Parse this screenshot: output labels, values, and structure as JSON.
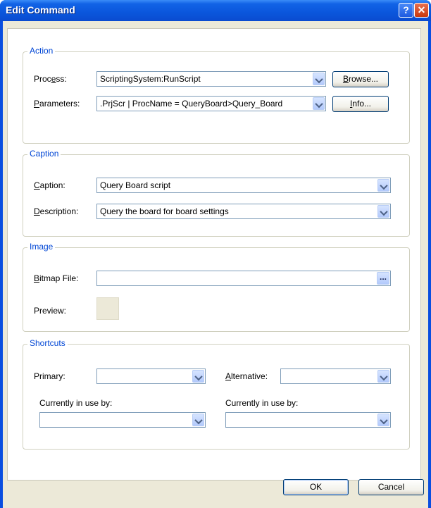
{
  "window": {
    "title": "Edit Command",
    "help_glyph": "?",
    "close_glyph": "✕"
  },
  "action": {
    "legend": "Action",
    "process_label": {
      "pre": "Proc",
      "u": "e",
      "post": "ss:"
    },
    "process_value": "ScriptingSystem:RunScript",
    "browse_label": {
      "pre": "",
      "u": "B",
      "post": "rowse..."
    },
    "parameters_label": {
      "pre": "",
      "u": "P",
      "post": "arameters:"
    },
    "parameters_value": ".PrjScr | ProcName = QueryBoard>Query_Board",
    "info_label": {
      "pre": "",
      "u": "I",
      "post": "nfo..."
    }
  },
  "caption": {
    "legend": "Caption",
    "caption_label": {
      "pre": "",
      "u": "C",
      "post": "aption:"
    },
    "caption_value": "Query Board script",
    "description_label": {
      "pre": "",
      "u": "D",
      "post": "escription:"
    },
    "description_value": "Query the board for board settings"
  },
  "image": {
    "legend": "Image",
    "bitmap_label": {
      "pre": "",
      "u": "B",
      "post": "itmap File:"
    },
    "bitmap_value": "",
    "ellipsis": "...",
    "preview_label": "Preview:"
  },
  "shortcuts": {
    "legend": "Shortcuts",
    "primary_label": "Primary:",
    "primary_value": "",
    "alternative_label": {
      "pre": "",
      "u": "A",
      "post": "lternative:"
    },
    "alternative_value": "",
    "in_use_left_label": "Currently in use by:",
    "in_use_left_value": "",
    "in_use_right_label": "Currently in use by:",
    "in_use_right_value": ""
  },
  "footer": {
    "ok_label": "OK",
    "cancel_label": "Cancel"
  }
}
